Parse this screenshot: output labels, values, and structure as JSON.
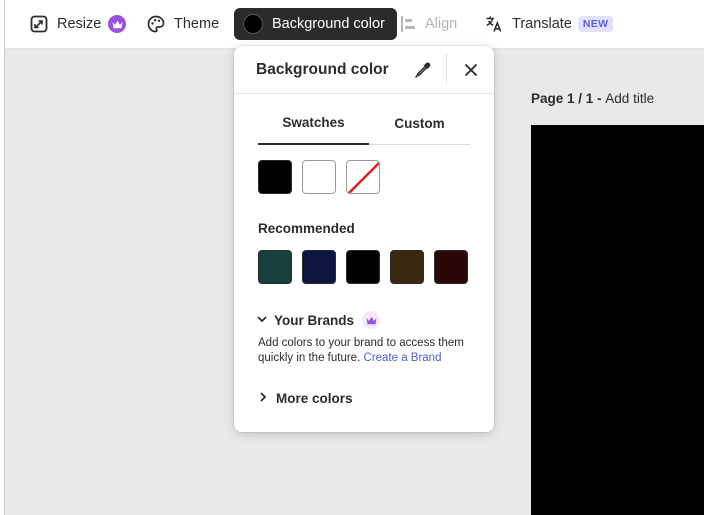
{
  "toolbar": {
    "resize_label": "Resize",
    "theme_label": "Theme",
    "background_color_label": "Background color",
    "align_label": "Align",
    "translate_label": "Translate",
    "translate_badge": "NEW"
  },
  "page": {
    "page_indicator": "Page 1 / 1",
    "separator": " - ",
    "add_title": "Add title",
    "canvas_color": "#000000"
  },
  "panel": {
    "title": "Background color",
    "tabs": [
      {
        "label": "Swatches",
        "active": true
      },
      {
        "label": "Custom",
        "active": false
      }
    ],
    "swatches": [
      "#000000",
      "#ffffff",
      "none"
    ],
    "recommended_label": "Recommended",
    "recommended": [
      "#173f3c",
      "#0d1541",
      "#000000",
      "#38290f",
      "#2a0608"
    ],
    "brands_label": "Your Brands",
    "brands_description": "Add colors to your brand to access them quickly in the future.",
    "brands_link": "Create a Brand",
    "more_colors_label": "More colors"
  },
  "icons": {
    "resize": "resize-icon",
    "crown": "crown-icon",
    "theme": "palette-icon",
    "align": "align-icon",
    "translate": "translate-icon",
    "eyedropper": "eyedropper-icon",
    "close": "close-icon",
    "chevron_down": "chevron-down-icon",
    "chevron_right": "chevron-right-icon"
  }
}
